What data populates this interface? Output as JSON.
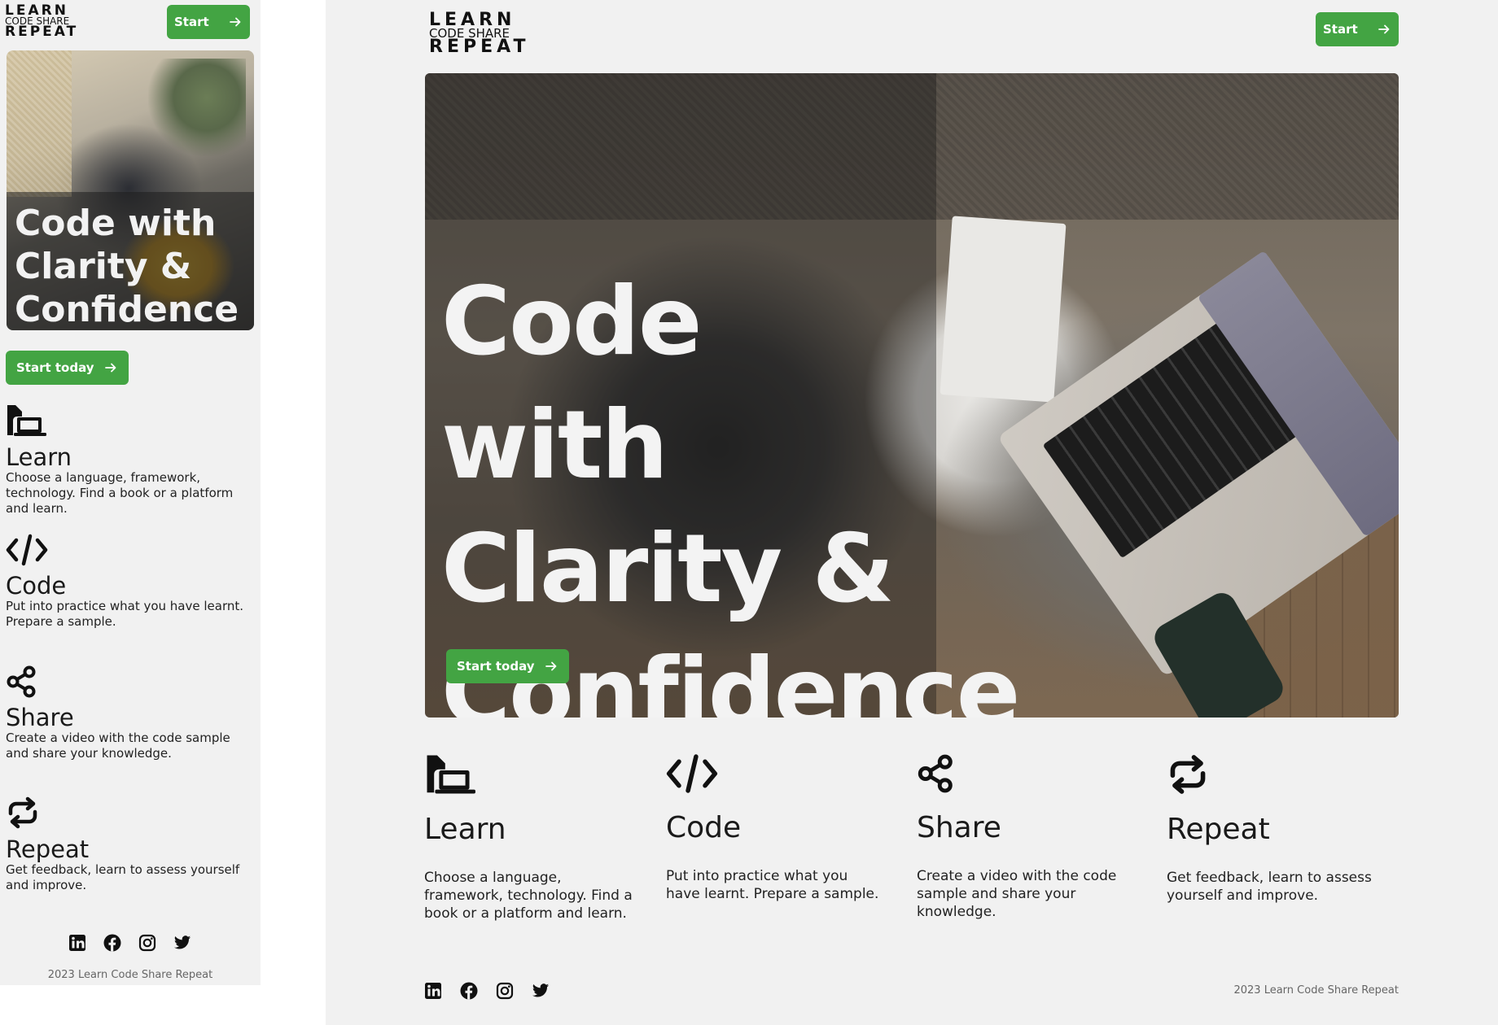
{
  "brand": {
    "line1": "LEARN",
    "line2": "CODE SHARE",
    "line3": "REPEAT"
  },
  "header": {
    "start_label": "Start"
  },
  "hero": {
    "heading": "Code with Clarity & Confidence",
    "cta_label": "Start today"
  },
  "features": [
    {
      "icon": "learn-book-laptop-icon",
      "title": "Learn",
      "desc": "Choose a language, framework, technology. Find a book or a platform and learn."
    },
    {
      "icon": "code-brackets-icon",
      "title": "Code",
      "desc": "Put into practice what you have learnt. Prepare a sample."
    },
    {
      "icon": "share-icon",
      "title": "Share",
      "desc": "Create a video with the code sample and share your knowledge."
    },
    {
      "icon": "repeat-arrows-icon",
      "title": "Repeat",
      "desc": "Get feedback, learn to assess yourself and improve."
    }
  ],
  "social": [
    "linkedin-icon",
    "facebook-icon",
    "instagram-icon",
    "twitter-icon"
  ],
  "footer": {
    "copyright": "2023 Learn Code Share Repeat"
  },
  "colors": {
    "accent": "#43a443",
    "background": "#f1f1f1",
    "text": "#1a1a1a"
  }
}
